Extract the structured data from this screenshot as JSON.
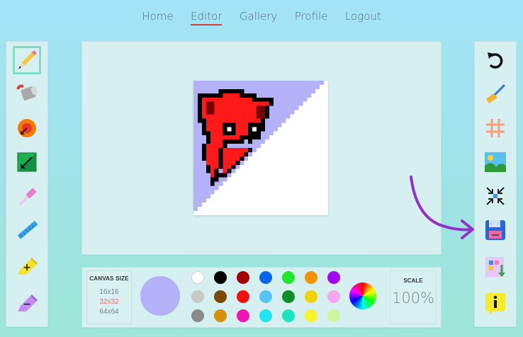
{
  "nav": {
    "items": [
      {
        "label": "Home"
      },
      {
        "label": "Editor",
        "active": true
      },
      {
        "label": "Gallery"
      },
      {
        "label": "Profile"
      },
      {
        "label": "Logout"
      }
    ]
  },
  "left_toolbar": {
    "tools": [
      {
        "name": "pencil-icon",
        "selected": true
      },
      {
        "name": "paint-bucket-icon"
      },
      {
        "name": "circle-tool-icon"
      },
      {
        "name": "rectangle-tool-icon"
      },
      {
        "name": "eyedropper-icon"
      },
      {
        "name": "ruler-line-icon"
      },
      {
        "name": "lighten-plus-icon"
      },
      {
        "name": "darken-minus-icon"
      }
    ]
  },
  "right_toolbar": {
    "tools": [
      {
        "name": "undo-icon"
      },
      {
        "name": "broom-clear-icon"
      },
      {
        "name": "grid-icon"
      },
      {
        "name": "image-import-icon"
      },
      {
        "name": "compress-icon"
      },
      {
        "name": "save-floppy-icon"
      },
      {
        "name": "palette-swap-icon"
      },
      {
        "name": "info-icon"
      }
    ]
  },
  "canvas_size": {
    "title": "CANVAS SIZE",
    "options": [
      {
        "label": "16x16"
      },
      {
        "label": "32x32",
        "active": true
      },
      {
        "label": "64x64"
      }
    ]
  },
  "current_color": "#b3b2f8",
  "palette": [
    [
      "#ffffff",
      "#000000",
      "#a50000",
      "#0a66e8",
      "#22e62c",
      "#f29400",
      "#a106f2"
    ],
    [
      "#c8c8c8",
      "#7a4a06",
      "#f01010",
      "#55c4f2",
      "#0f8f2a",
      "#f2d300",
      "#f5a6f0"
    ],
    [
      "#8a8a8a",
      "#d4920a",
      "#f016b4",
      "#1ee6f2",
      "#19e6c0",
      "#f7f42a",
      "#cdf79c"
    ]
  ],
  "scale": {
    "title": "SCALE",
    "value": "100%"
  },
  "colors": {
    "canvas_bg": "#b3b2f8",
    "cat_red": "#ff1a1a",
    "outline": "#000000"
  }
}
